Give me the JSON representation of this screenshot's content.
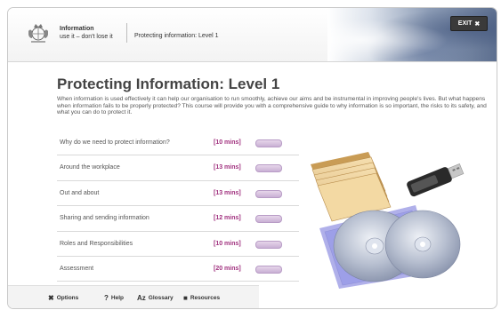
{
  "header": {
    "brand_title": "Information",
    "brand_tagline": "use it – don't lose it",
    "course_label": "Protecting information: Level 1",
    "exit_label": "EXIT",
    "exit_icon": "close-icon"
  },
  "main": {
    "title": "Protecting Information: Level 1",
    "intro": "When information is used effectively it can help our organisation to run smoothly, achieve our aims and be instrumental in improving people's lives. But what happens when information fails to be properly protected? This course will provide you with a comprehensive guide to why information is so important, the risks to its safety, and what you can do to protect it."
  },
  "modules": [
    {
      "title": "Why do we need to protect information?",
      "duration": "[10 mins]"
    },
    {
      "title": "Around the workplace",
      "duration": "[13 mins]"
    },
    {
      "title": "Out and about",
      "duration": "[13 mins]"
    },
    {
      "title": "Sharing and sending information",
      "duration": "[12 mins]"
    },
    {
      "title": "Roles and Responsibilities",
      "duration": "[10 mins]"
    },
    {
      "title": "Assessment",
      "duration": "[20 mins]"
    }
  ],
  "footer": {
    "options_label": "Options",
    "help_label": "Help",
    "glossary_label": "Glossary",
    "resources_label": "Resources"
  },
  "colors": {
    "accent": "#a0307e",
    "pill": "#c9b0d4",
    "exit_bg": "#3a3a3a"
  }
}
